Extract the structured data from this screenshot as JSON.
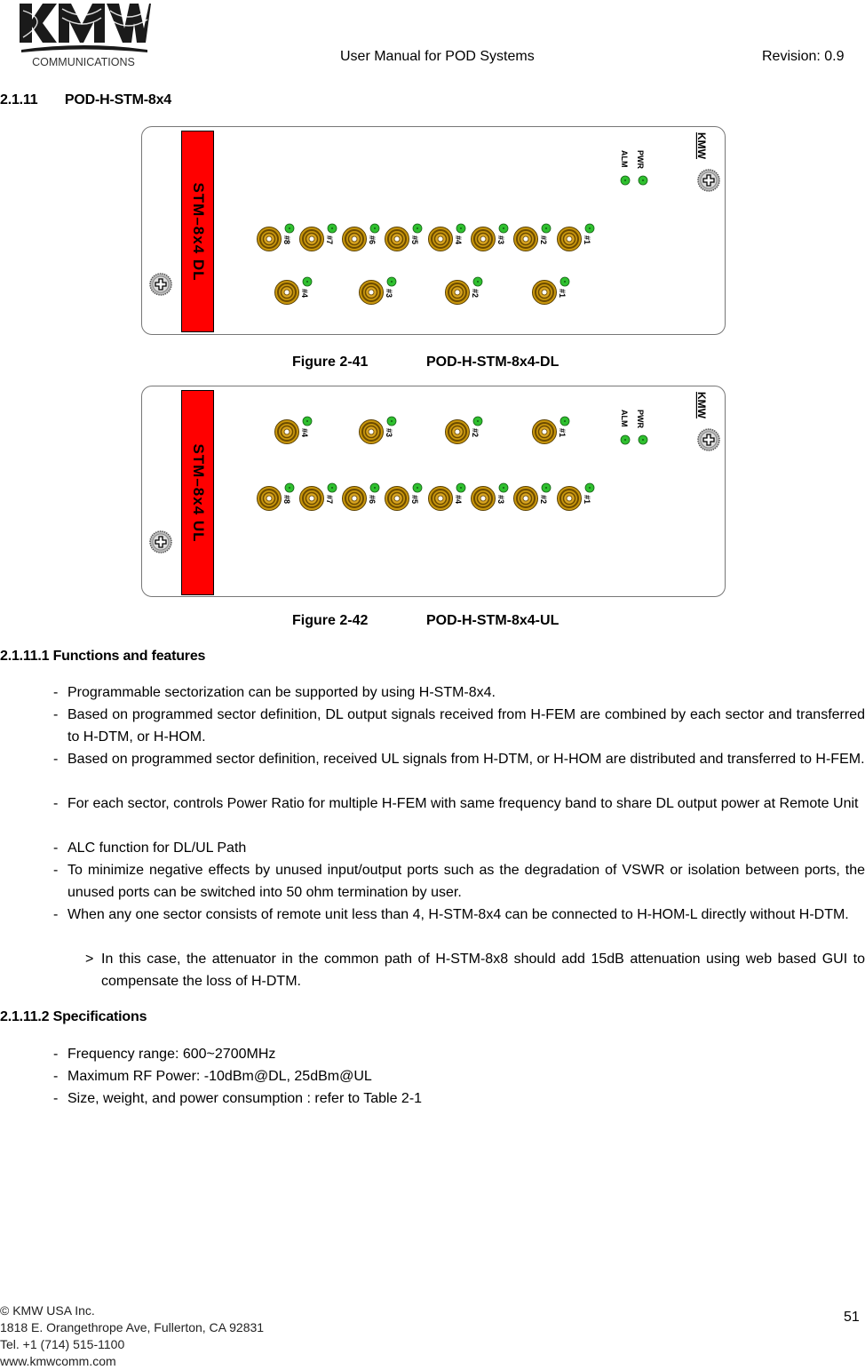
{
  "header": {
    "logo_text": "KMW",
    "logo_sub": "COMMUNICATIONS",
    "title": "User Manual for POD Systems",
    "revision": "Revision: 0.9"
  },
  "section": {
    "number": "2.1.11",
    "title": "POD-H-STM-8x4"
  },
  "figures": [
    {
      "caption_number": "Figure 2-41",
      "caption_title": "POD-H-STM-8x4-DL",
      "module_label": "STM–8x4 DL",
      "brand": "KMW",
      "led_labels": [
        "PWR",
        "ALM"
      ],
      "row8_ports": [
        "#8",
        "#7",
        "#6",
        "#5",
        "#4",
        "#3",
        "#2",
        "#1"
      ],
      "row4_ports": [
        "#4",
        "#3",
        "#2",
        "#1"
      ],
      "layout": "8-top-4-bottom"
    },
    {
      "caption_number": "Figure 2-42",
      "caption_title": "POD-H-STM-8x4-UL",
      "module_label": "STM–8x4 UL",
      "brand": "KMW",
      "led_labels": [
        "PWR",
        "ALM"
      ],
      "row8_ports": [
        "#8",
        "#7",
        "#6",
        "#5",
        "#4",
        "#3",
        "#2",
        "#1"
      ],
      "row4_ports": [
        "#4",
        "#3",
        "#2",
        "#1"
      ],
      "layout": "4-top-8-bottom"
    }
  ],
  "functions": {
    "heading": "2.1.11.1 Functions and features",
    "items": [
      "Programmable sectorization can be supported by using H-STM-8x4.",
      "Based on programmed sector definition, DL output signals received from H-FEM are combined by each sector and transferred to H-DTM, or H-HOM.",
      "Based on programmed sector definition, received UL signals from H-DTM, or H-HOM are distributed and transferred to H-FEM.",
      "For each sector, controls Power Ratio for multiple H-FEM with same frequency band to share DL output power at Remote Unit",
      "ALC function for DL/UL Path",
      "To minimize negative effects by unused input/output ports such as the degradation of VSWR or isolation between ports, the unused ports can be switched into 50 ohm termination by user.",
      "When any one sector consists of remote unit less than 4, H-STM-8x4 can be connected to H-HOM-L directly without H-DTM."
    ],
    "sub_item": "In this case, the attenuator in the common path of H-STM-8x8 should add 15dB attenuation using web based GUI to compensate the loss of H-DTM.",
    "bullet": "-",
    "sub_bullet": ">"
  },
  "specifications": {
    "heading": "2.1.11.2 Specifications",
    "items": [
      "Frequency range: 600~2700MHz",
      "Maximum RF Power: -10dBm@DL, 25dBm@UL",
      "Size, weight, and power consumption : refer to Table 2-1"
    ]
  },
  "footer": {
    "company": "© KMW USA Inc.",
    "address": "1818 E. Orangethrope Ave, Fullerton, CA 92831",
    "phone": "Tel. +1 (714) 515-1100",
    "website": "www.kmwcomm.com",
    "page_number": "51"
  },
  "colors": {
    "module_red": "#ff0000",
    "connector_gold": "#c8960c",
    "led_green": "#2fc02f",
    "panel_border": "#777777"
  }
}
